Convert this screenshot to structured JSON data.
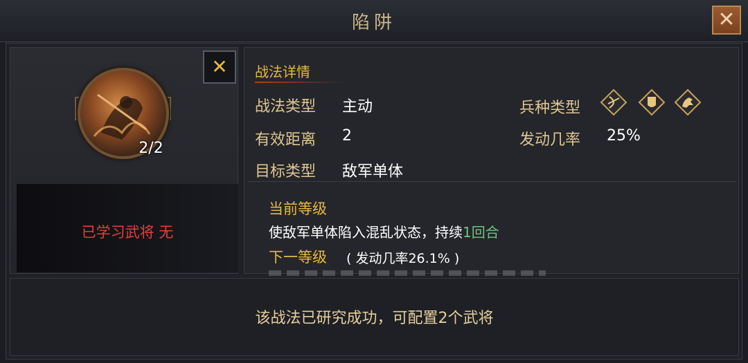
{
  "window": {
    "title": "陷阱"
  },
  "skill": {
    "level": "2/2",
    "learned_generals": "已学习武将 无"
  },
  "details": {
    "section_title": "战法详情",
    "type_label": "战法类型",
    "type_value": "主动",
    "troop_label": "兵种类型",
    "troop_icons": [
      "bow-troop-icon",
      "shield-troop-icon",
      "cavalry-troop-icon"
    ],
    "range_label": "有效距离",
    "range_value": "2",
    "rate_label": "发动几率",
    "rate_value": "25%",
    "target_label": "目标类型",
    "target_value": "敌军单体"
  },
  "current_level": {
    "title": "当前等级",
    "desc_before": "使敌军单体陷入混乱状态，持续",
    "desc_highlight": "1回合",
    "highlight_color": "#6fc383"
  },
  "next_level": {
    "title": "下一等级",
    "rate_note": "( 发动几率26.1% )"
  },
  "status": "该战法已研究成功，可配置2个武将",
  "colors": {
    "accent_gold": "#e9b83e",
    "label_tan": "#dfc593",
    "warning_red": "#e0403c"
  }
}
